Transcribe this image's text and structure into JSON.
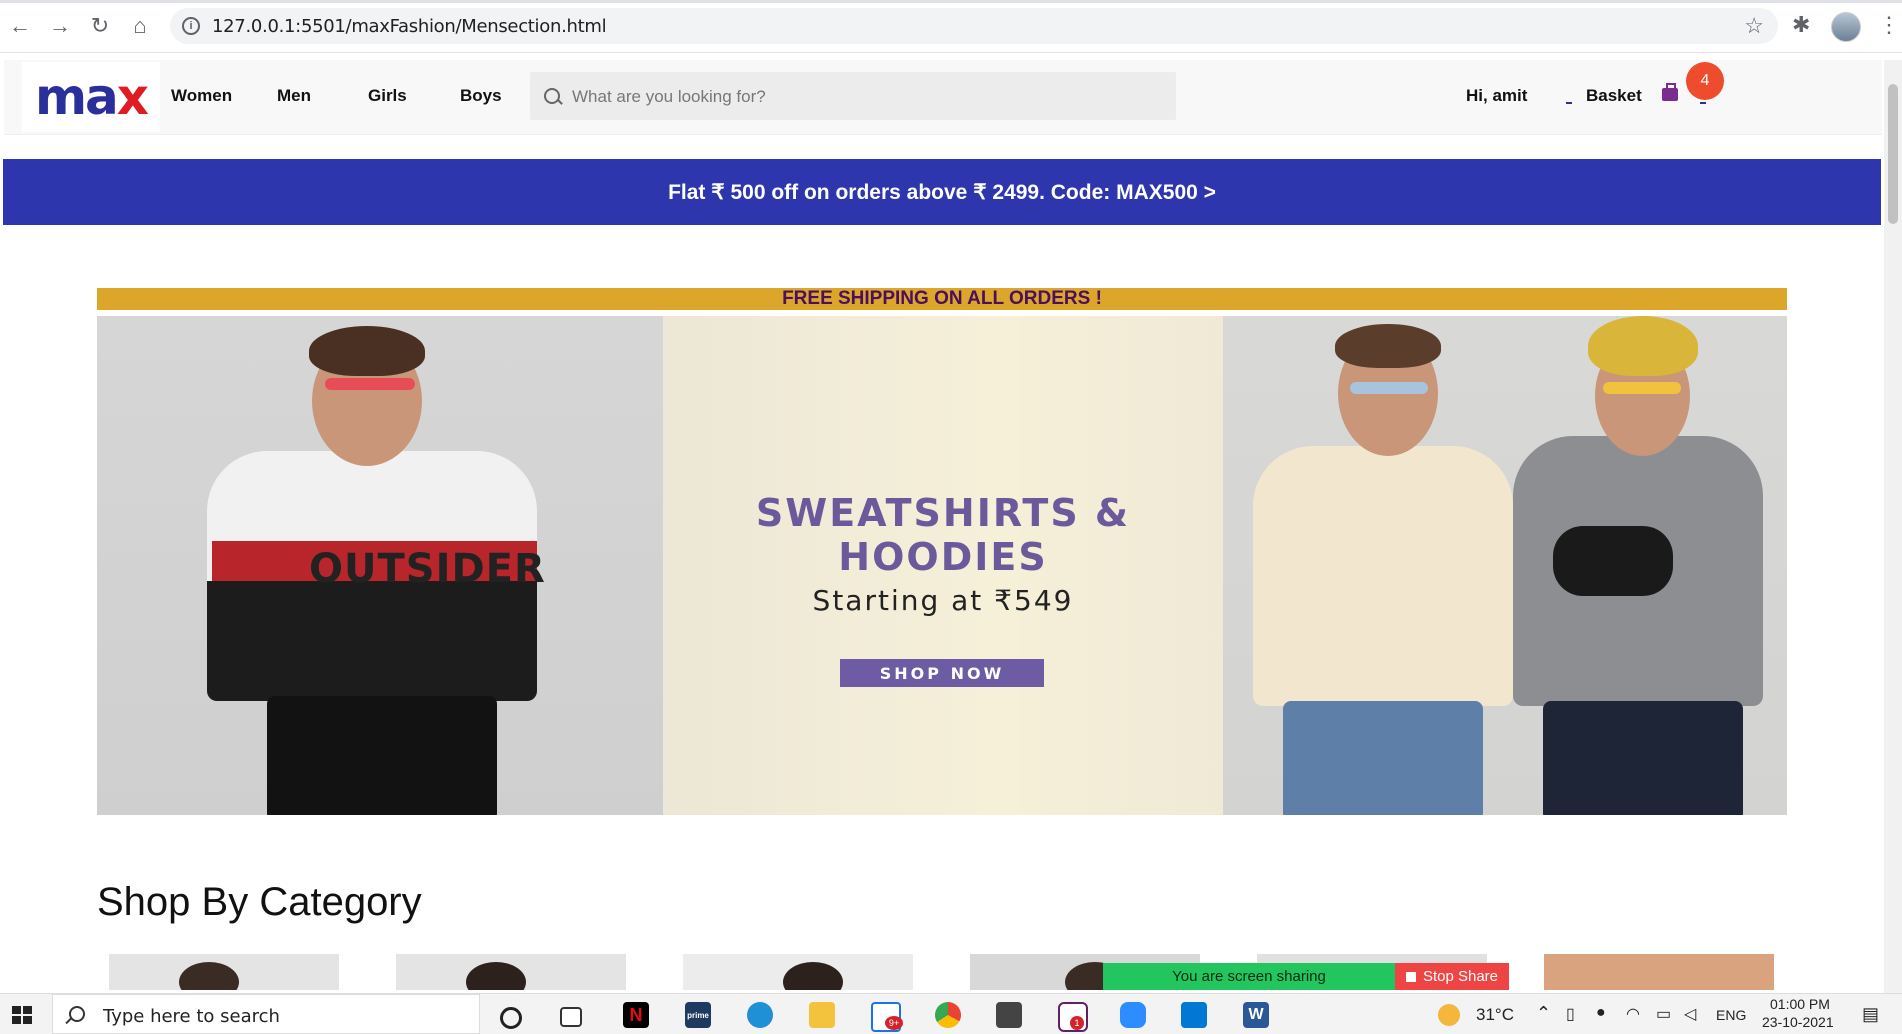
{
  "browser": {
    "url": "127.0.0.1:5501/maxFashion/Mensection.html",
    "back": "←",
    "forward": "→",
    "reload": "↻",
    "home": "⌂",
    "star": "☆",
    "extensions": "✱",
    "menu": "⋮"
  },
  "header": {
    "logo_m": "max",
    "nav": [
      "Women",
      "Men",
      "Girls",
      "Boys"
    ],
    "search_placeholder": "What are you looking for?",
    "greeting": "Hi, amit",
    "basket_label": "Basket",
    "basket_count": "4"
  },
  "promo_banner": "Flat ₹ 500 off on orders above ₹ 2499. Code: MAX500 >",
  "shipping_banner": "FREE SHIPPING ON ALL ORDERS !",
  "hero": {
    "heading_line1": "SWEATSHIRTS &",
    "heading_line2": "HOODIES",
    "subheading": "Starting at ₹549",
    "cta": "SHOP NOW",
    "hoodie_text": "OUTSIDER"
  },
  "category_section_title": "Shop By Category",
  "screen_share": {
    "status": "You are screen sharing",
    "stop": "Stop Share"
  },
  "taskbar": {
    "search_placeholder": "Type here to search",
    "weather": "31°C",
    "language": "ENG",
    "time": "01:00 PM",
    "date": "23-10-2021",
    "mail_badge": "9+",
    "slack_badge": "1"
  },
  "colors": {
    "brand_blue": "#2d36ac",
    "brand_red": "#e01b24",
    "shipping_gold": "#dba62a",
    "cta_purple": "#6d5ba3"
  }
}
